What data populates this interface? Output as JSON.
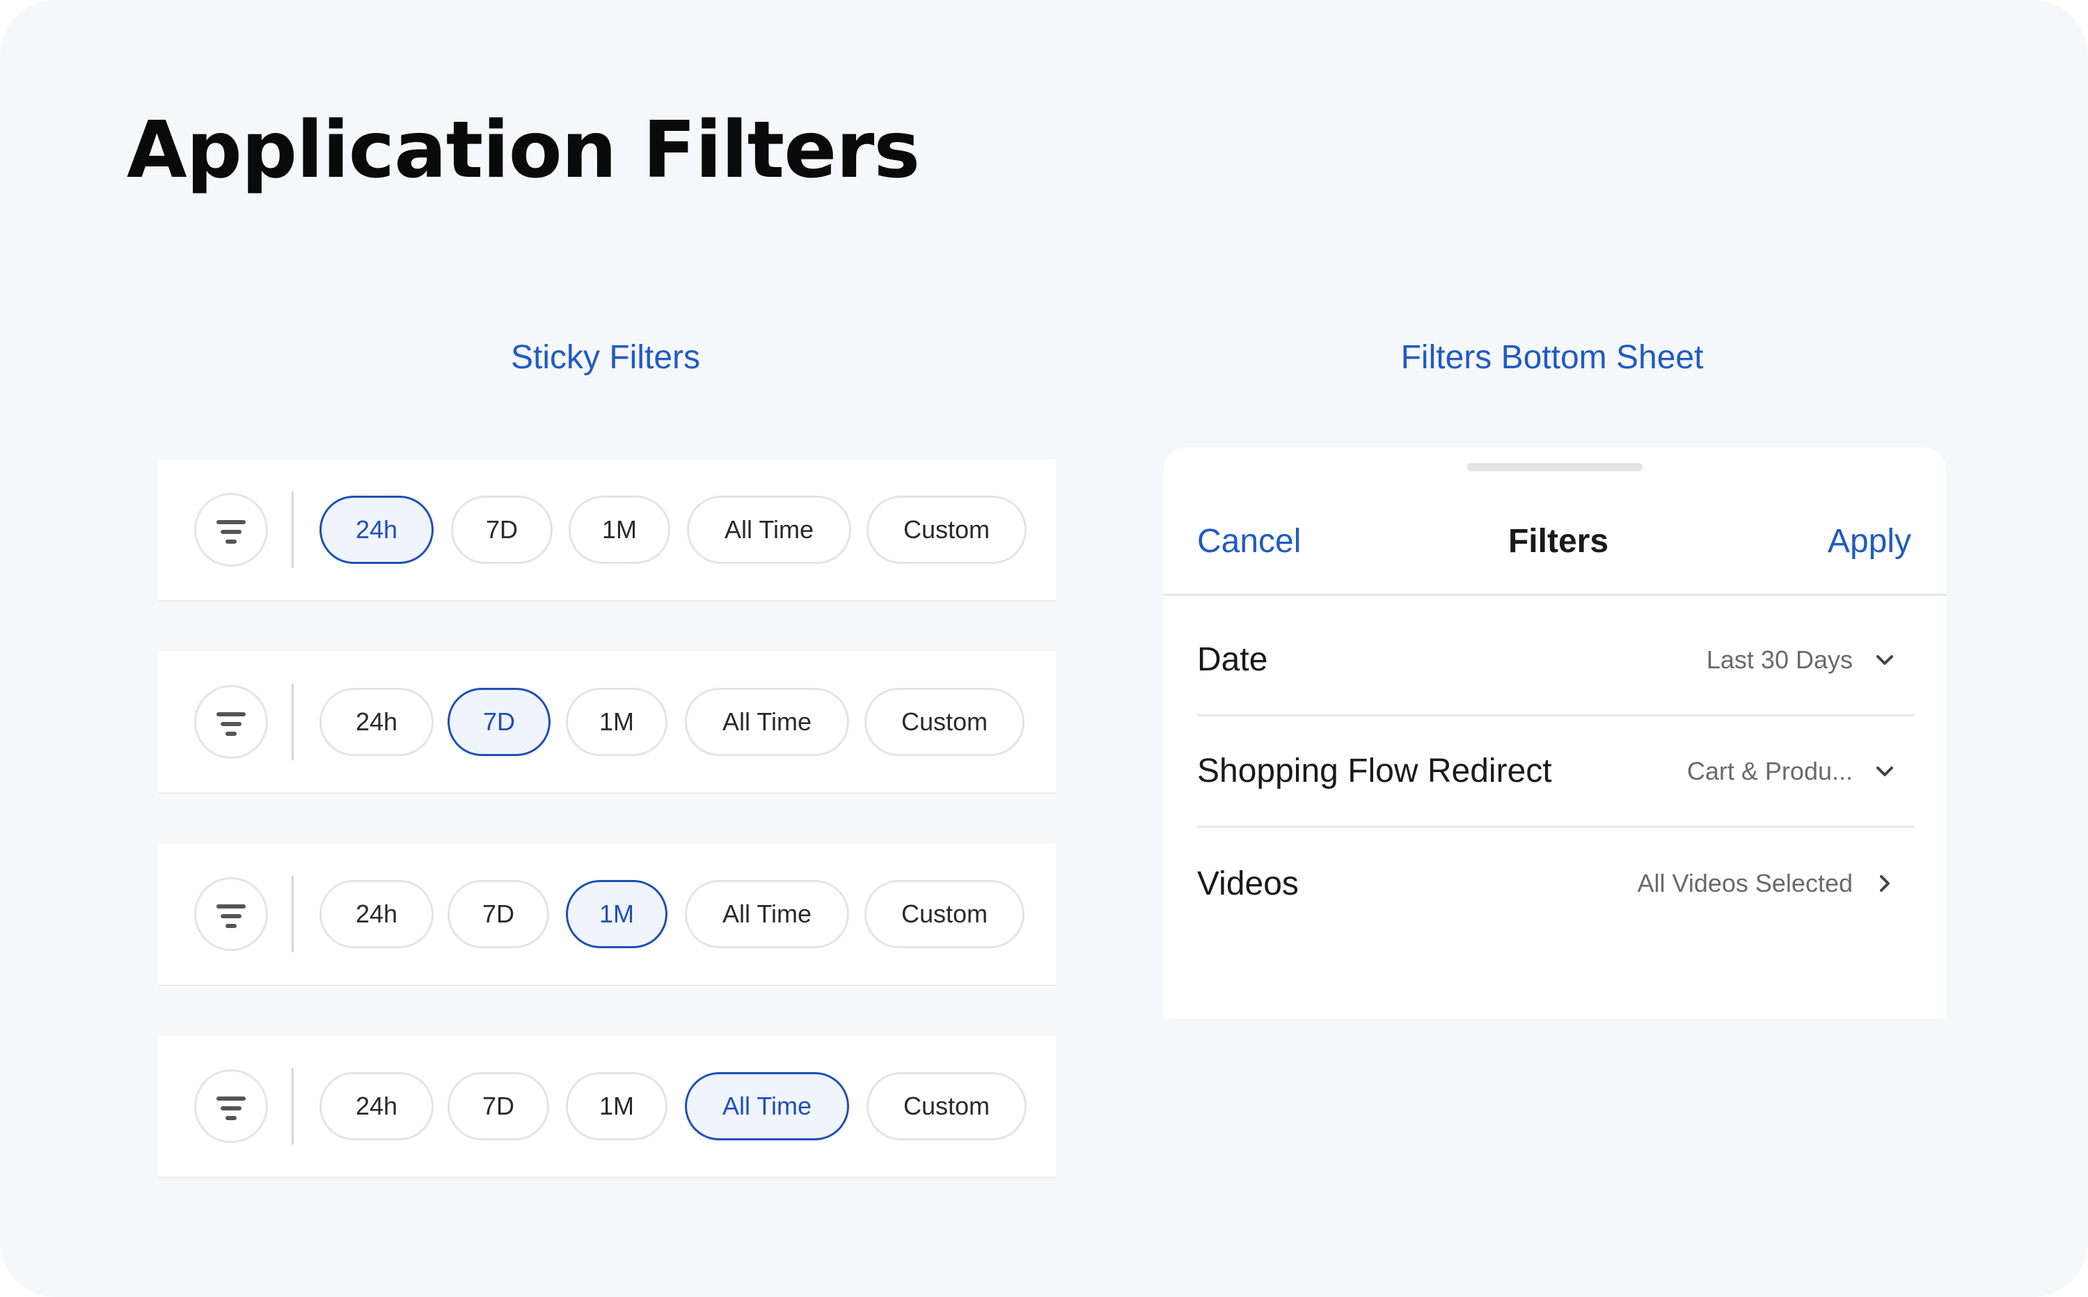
{
  "page_title": "Application Filters",
  "sections": {
    "sticky_filters_title": "Sticky Filters",
    "bottom_sheet_title": "Filters Bottom Sheet"
  },
  "colors": {
    "accent": "#1f5bc4",
    "background": "#f6f7fb",
    "active_pill_fill": "#f0f4fd"
  },
  "sticky_filters": {
    "options": [
      "24h",
      "7D",
      "1M",
      "All Time",
      "Custom"
    ],
    "filter_icon": "filter-lines-icon",
    "bars": [
      {
        "selected": "24h"
      },
      {
        "selected": "7D"
      },
      {
        "selected": "1M"
      },
      {
        "selected": "All Time"
      }
    ]
  },
  "bottom_sheet": {
    "cancel_label": "Cancel",
    "title": "Filters",
    "apply_label": "Apply",
    "rows": [
      {
        "label": "Date",
        "value": "Last 30 Days",
        "icon": "chevron-down-icon"
      },
      {
        "label": "Shopping Flow Redirect",
        "value": "Cart & Produ...",
        "icon": "chevron-down-icon"
      },
      {
        "label": "Videos",
        "value": "All Videos Selected",
        "icon": "chevron-right-icon"
      }
    ]
  }
}
